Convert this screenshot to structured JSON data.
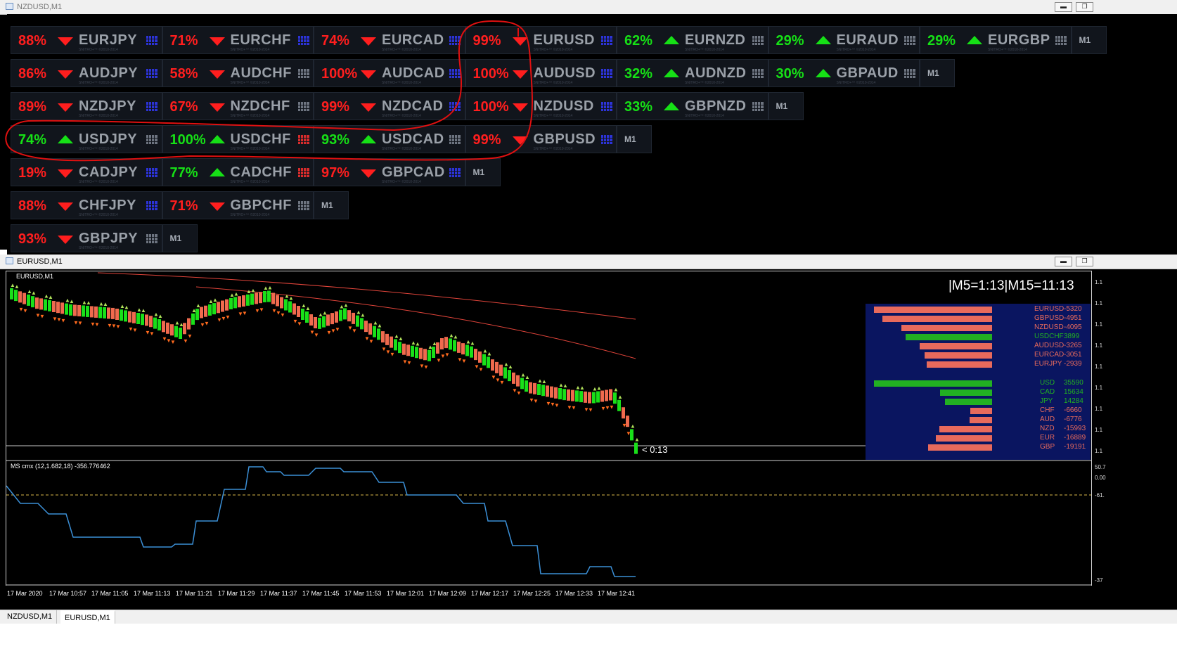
{
  "window1": {
    "title": "NZDUSD,M1"
  },
  "window2": {
    "title": "EURUSD,M1"
  },
  "window_buttons": {
    "minimize": "▬",
    "restore": "❐"
  },
  "colors": {
    "down": "#ff1e1e",
    "up": "#16e016",
    "symbol": "#9aa0a8",
    "grid_blue": "#2c33d6",
    "grid_red": "#d62c2c",
    "grid_gray": "#6d7480"
  },
  "panel_watermark": "SNITRO+™ ©2010-2014",
  "panel_rows": [
    {
      "cells": [
        {
          "pct": "88%",
          "dir": "down",
          "sym": "EURJPY",
          "grid": "blue"
        },
        {
          "pct": "71%",
          "dir": "down",
          "sym": "EURCHF",
          "grid": "blue"
        },
        {
          "pct": "74%",
          "dir": "down",
          "sym": "EURCAD",
          "grid": "blue"
        },
        {
          "pct": "99%",
          "dir": "down",
          "sym": "EURUSD",
          "grid": "blue"
        },
        {
          "pct": "62%",
          "dir": "up",
          "sym": "EURNZD",
          "grid": "gray"
        },
        {
          "pct": "29%",
          "dir": "up",
          "sym": "EURAUD",
          "grid": "gray"
        },
        {
          "pct": "29%",
          "dir": "up",
          "sym": "EURGBP",
          "grid": "gray"
        }
      ],
      "end": "M1"
    },
    {
      "cells": [
        {
          "pct": "86%",
          "dir": "down",
          "sym": "AUDJPY",
          "grid": "blue"
        },
        {
          "pct": "58%",
          "dir": "down",
          "sym": "AUDCHF",
          "grid": "gray"
        },
        {
          "pct": "100%",
          "dir": "down",
          "sym": "AUDCAD",
          "grid": "blue"
        },
        {
          "pct": "100%",
          "dir": "down",
          "sym": "AUDUSD",
          "grid": "blue"
        },
        {
          "pct": "32%",
          "dir": "up",
          "sym": "AUDNZD",
          "grid": "gray"
        },
        {
          "pct": "30%",
          "dir": "up",
          "sym": "GBPAUD",
          "grid": "gray"
        }
      ],
      "end": "M1"
    },
    {
      "cells": [
        {
          "pct": "89%",
          "dir": "down",
          "sym": "NZDJPY",
          "grid": "blue"
        },
        {
          "pct": "67%",
          "dir": "down",
          "sym": "NZDCHF",
          "grid": "gray"
        },
        {
          "pct": "99%",
          "dir": "down",
          "sym": "NZDCAD",
          "grid": "blue"
        },
        {
          "pct": "100%",
          "dir": "down",
          "sym": "NZDUSD",
          "grid": "blue"
        },
        {
          "pct": "33%",
          "dir": "up",
          "sym": "GBPNZD",
          "grid": "gray"
        }
      ],
      "end": "M1"
    },
    {
      "cells": [
        {
          "pct": "74%",
          "dir": "up",
          "sym": "USDJPY",
          "grid": "gray"
        },
        {
          "pct": "100%",
          "dir": "up",
          "sym": "USDCHF",
          "grid": "red"
        },
        {
          "pct": "93%",
          "dir": "up",
          "sym": "USDCAD",
          "grid": "gray"
        },
        {
          "pct": "99%",
          "dir": "down",
          "sym": "GBPUSD",
          "grid": "blue"
        }
      ],
      "end": "M1"
    },
    {
      "cells": [
        {
          "pct": "19%",
          "dir": "down",
          "sym": "CADJPY",
          "grid": "blue"
        },
        {
          "pct": "77%",
          "dir": "up",
          "sym": "CADCHF",
          "grid": "red"
        },
        {
          "pct": "97%",
          "dir": "down",
          "sym": "GBPCAD",
          "grid": "blue"
        }
      ],
      "end": "M1"
    },
    {
      "cells": [
        {
          "pct": "88%",
          "dir": "down",
          "sym": "CHFJPY",
          "grid": "blue"
        },
        {
          "pct": "71%",
          "dir": "down",
          "sym": "GBPCHF",
          "grid": "gray"
        }
      ],
      "end": "M1"
    },
    {
      "cells": [
        {
          "pct": "93%",
          "dir": "down",
          "sym": "GBPJPY",
          "grid": "gray"
        }
      ],
      "end": "M1"
    }
  ],
  "chart": {
    "symbol_label": "EURUSD,M1",
    "timer_label": "|M5=1:13|M15=11:13",
    "countdown": "< 0:13",
    "indicator_label": "MS cmx (12,1.682,18) -356.776462",
    "price_ticks": [
      "1.1",
      "1.1",
      "1.1",
      "1.1",
      "1.1",
      "1.1",
      "1.1",
      "1.1",
      "1.1"
    ],
    "indicator_ticks": [
      "50.7",
      "0.00",
      "-61.",
      "-37"
    ],
    "date_labels": [
      "17 Mar 2020",
      "17 Mar 10:57",
      "17 Mar 11:05",
      "17 Mar 11:13",
      "17 Mar 11:21",
      "17 Mar 11:29",
      "17 Mar 11:37",
      "17 Mar 11:45",
      "17 Mar 11:53",
      "17 Mar 12:01",
      "17 Mar 12:09",
      "17 Mar 12:17",
      "17 Mar 12:25",
      "17 Mar 12:33",
      "17 Mar 12:41"
    ]
  },
  "strength_pairs": [
    {
      "name": "EURUSD",
      "value": -5320
    },
    {
      "name": "GBPUSD",
      "value": -4951
    },
    {
      "name": "NZDUSD",
      "value": -4095
    },
    {
      "name": "USDCHF",
      "value": 3899
    },
    {
      "name": "AUDUSD",
      "value": -3265
    },
    {
      "name": "EURCAD",
      "value": -3051
    },
    {
      "name": "EURJPY",
      "value": -2939
    }
  ],
  "strength_currencies": [
    {
      "name": "USD",
      "value": 35590
    },
    {
      "name": "CAD",
      "value": 15634
    },
    {
      "name": "JPY",
      "value": 14284
    },
    {
      "name": "CHF",
      "value": -6660
    },
    {
      "name": "AUD",
      "value": -6776
    },
    {
      "name": "NZD",
      "value": -15993
    },
    {
      "name": "EUR",
      "value": -16889
    },
    {
      "name": "GBP",
      "value": -19191
    }
  ],
  "tabs": [
    "NZDUSD,M1",
    "EURUSD,M1"
  ]
}
